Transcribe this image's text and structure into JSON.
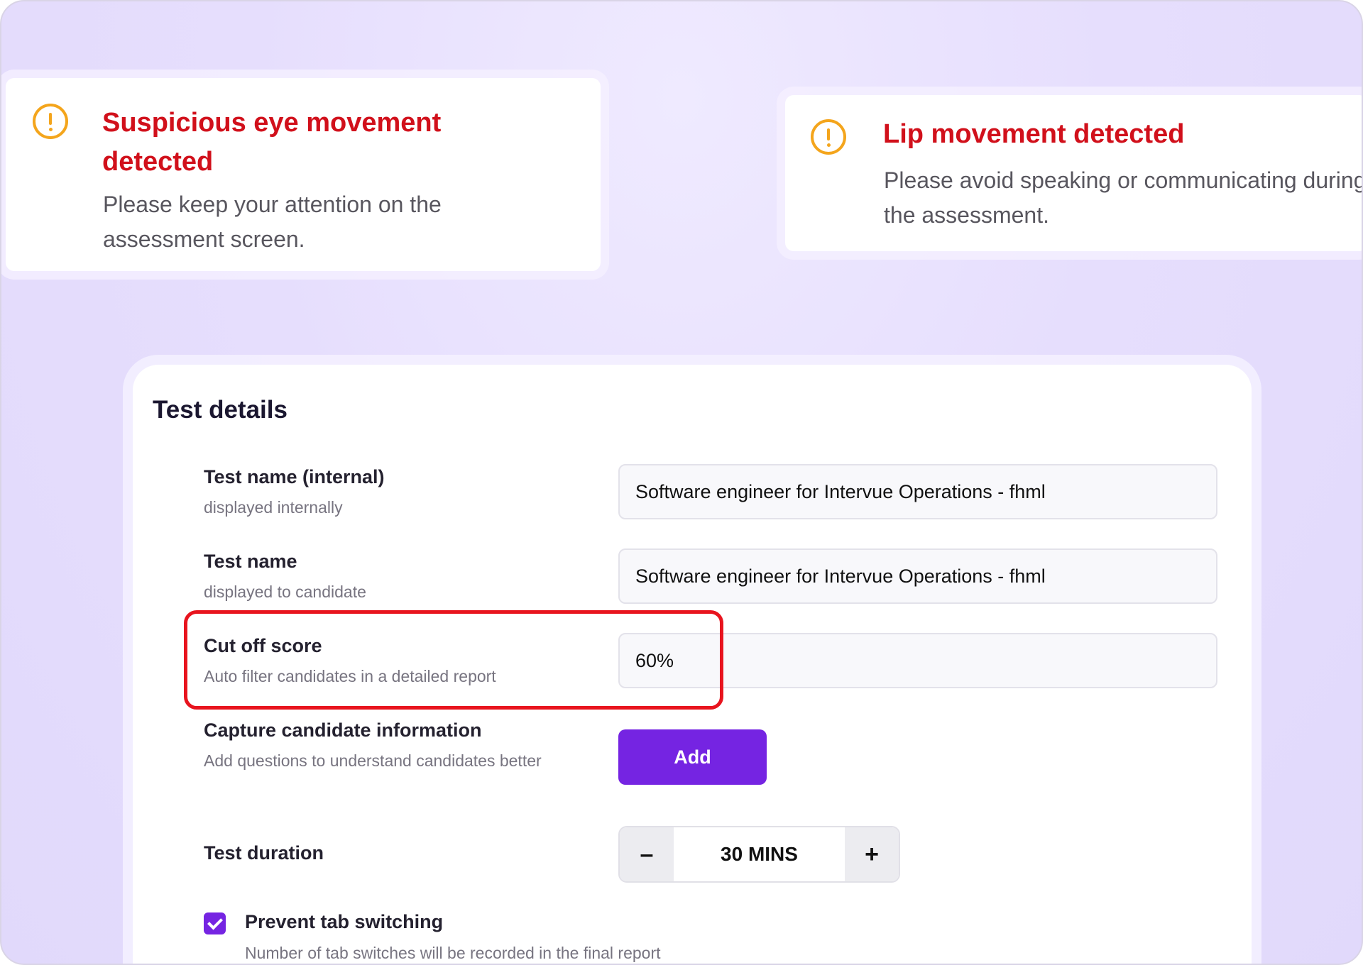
{
  "alerts": [
    {
      "icon": "warning-icon",
      "title": "Suspicious eye movement detected",
      "message": "Please keep your attention on the assessment screen."
    },
    {
      "icon": "warning-icon",
      "title": "Lip movement detected",
      "message": "Please avoid speaking or communicating during the assessment."
    }
  ],
  "test_details": {
    "title": "Test details",
    "internal_name": {
      "label": "Test name (internal)",
      "sublabel": "displayed internally",
      "value": "Software engineer for Intervue Operations - fhml"
    },
    "candidate_name": {
      "label": "Test name",
      "sublabel": "displayed to candidate",
      "value": "Software engineer for Intervue Operations - fhml"
    },
    "cutoff": {
      "label": "Cut off score",
      "sublabel": "Auto filter candidates in a detailed report",
      "value": "60%"
    },
    "capture": {
      "label": "Capture candidate information",
      "sublabel": "Add questions to understand candidates better",
      "button": "Add"
    },
    "duration": {
      "label": "Test duration",
      "value": "30 MINS",
      "decrement": "–",
      "increment": "+"
    },
    "tab_switching": {
      "label": "Prevent tab switching",
      "sublabel": "Number of tab switches will be recorded in the final report",
      "checked": true
    }
  },
  "colors": {
    "accent": "#7524e2",
    "alert_title": "#d1101b",
    "warning_icon": "#f4a51c",
    "highlight": "#e8141e"
  }
}
